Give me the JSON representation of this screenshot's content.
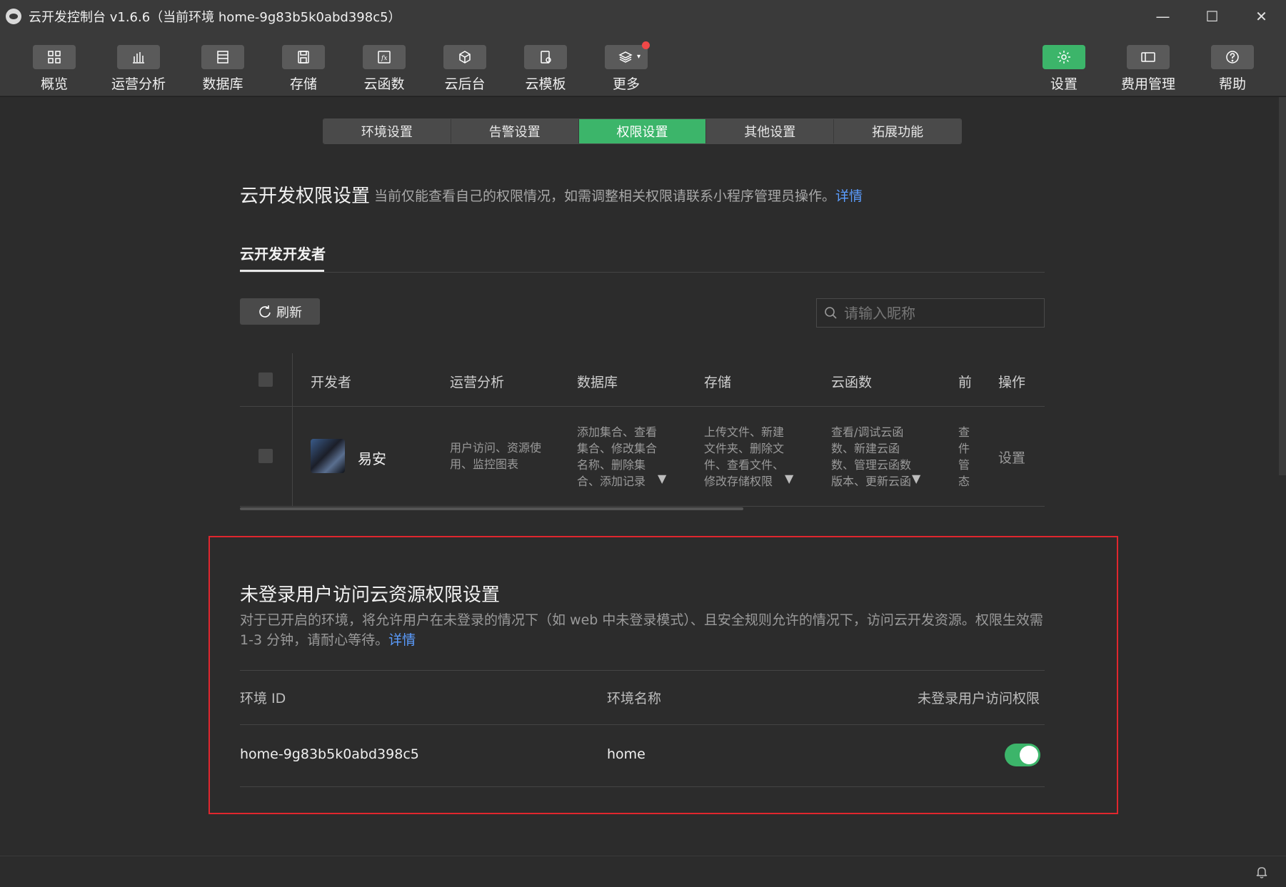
{
  "window": {
    "title": "云开发控制台 v1.6.6（当前环境 home-9g83b5k0abd398c5）",
    "controls": [
      "—",
      "☐",
      "✕"
    ]
  },
  "toolbar": {
    "left": [
      {
        "label": "概览",
        "icon": "grid-icon"
      },
      {
        "label": "运营分析",
        "icon": "bar-chart-icon"
      },
      {
        "label": "数据库",
        "icon": "database-icon"
      },
      {
        "label": "存储",
        "icon": "save-icon"
      },
      {
        "label": "云函数",
        "icon": "function-icon"
      },
      {
        "label": "云后台",
        "icon": "cube-icon"
      },
      {
        "label": "云模板",
        "icon": "template-icon"
      },
      {
        "label": "更多",
        "icon": "layers-icon",
        "badge": true
      }
    ],
    "right": [
      {
        "label": "设置",
        "icon": "gear-icon",
        "active": true
      },
      {
        "label": "费用管理",
        "icon": "billing-icon"
      },
      {
        "label": "帮助",
        "icon": "help-icon"
      }
    ]
  },
  "tabs": [
    {
      "label": "环境设置",
      "active": false
    },
    {
      "label": "告警设置",
      "active": false
    },
    {
      "label": "权限设置",
      "active": true
    },
    {
      "label": "其他设置",
      "active": false
    },
    {
      "label": "拓展功能",
      "active": false
    }
  ],
  "permissions": {
    "title": "云开发权限设置",
    "description": "当前仅能查看自己的权限情况，如需调整相关权限请联系小程序管理员操作。",
    "detail_link": "详情",
    "subtab": "云开发开发者",
    "refresh_label": "刷新",
    "search_placeholder": "请输入昵称"
  },
  "dev_table": {
    "headers": [
      "开发者",
      "运营分析",
      "数据库",
      "存储",
      "云函数",
      "前",
      "操作"
    ],
    "rows": [
      {
        "name": "易安",
        "ops": "用户访问、资源使用、监控图表",
        "db": "添加集合、查看集合、修改集合名称、删除集合、添加记录",
        "storage": "上传文件、新建文件夹、删除文件、查看文件、修改存储权限",
        "functions": "查看/调试云函数、新建云函数、管理云函数版本、更新云函数",
        "front": "查件管态",
        "action": "设置"
      }
    ]
  },
  "anon_access": {
    "title": "未登录用户访问云资源权限设置",
    "description": "对于已开启的环境，将允许用户在未登录的情况下（如 web 中未登录模式）、且安全规则允许的情况下，访问云开发资源。权限生效需 1-3 分钟，请耐心等待。",
    "detail_link": "详情",
    "headers": {
      "env_id": "环境 ID",
      "env_name": "环境名称",
      "access": "未登录用户访问权限"
    },
    "rows": [
      {
        "env_id": "home-9g83b5k0abd398c5",
        "env_name": "home",
        "enabled": true
      }
    ]
  },
  "colors": {
    "accent": "#3cb56a",
    "link": "#5b9dff",
    "highlight_box": "#e0262e"
  }
}
